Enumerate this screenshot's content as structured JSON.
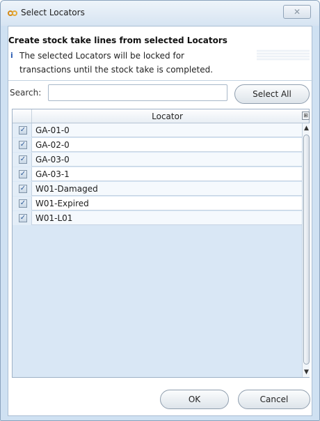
{
  "window": {
    "title": "Select Locators",
    "close_glyph": "✕",
    "icon": "link-chain-icon"
  },
  "header": {
    "text": "Create stock take lines from selected Locators",
    "info_icon_glyph": "i",
    "info_line1": "The selected Locators will be locked for",
    "info_line2": "transactions until the stock take is completed."
  },
  "search": {
    "label": "Search:",
    "value": "",
    "placeholder": ""
  },
  "buttons": {
    "select_all": "Select All",
    "ok": "OK",
    "cancel": "Cancel"
  },
  "grid": {
    "column_header": "Locator",
    "menu_glyph": "⊞",
    "check_glyph": "✓",
    "rows": [
      {
        "locator": "GA-01-0",
        "checked": true
      },
      {
        "locator": "GA-02-0",
        "checked": true
      },
      {
        "locator": "GA-03-0",
        "checked": true
      },
      {
        "locator": "GA-03-1",
        "checked": true
      },
      {
        "locator": "W01-Damaged",
        "checked": true
      },
      {
        "locator": "W01-Expired",
        "checked": true
      },
      {
        "locator": "W01-L01",
        "checked": true
      }
    ]
  },
  "scrollbar": {
    "up_glyph": "▲",
    "down_glyph": "▼"
  },
  "colors": {
    "window_bg": "#cfe1f2",
    "grid_empty_bg": "#d9e7f5",
    "accent": "#2a5cb3"
  }
}
